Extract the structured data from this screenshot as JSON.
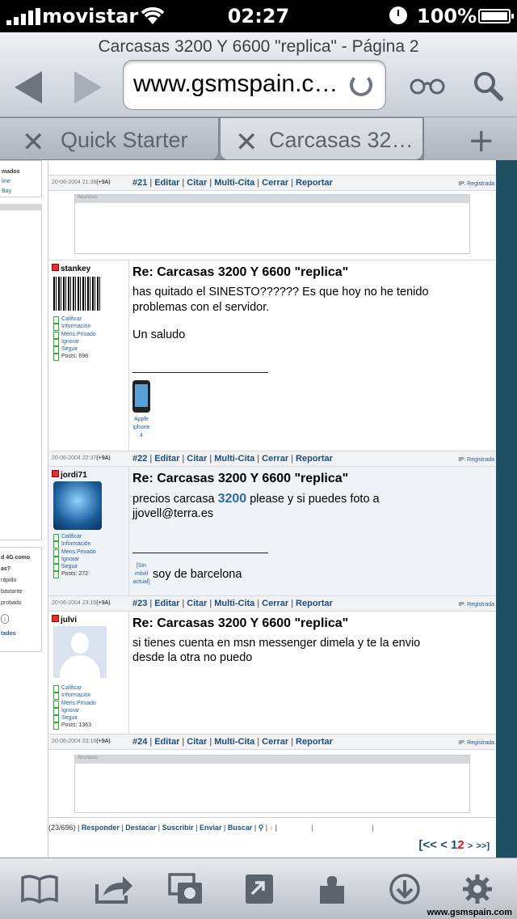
{
  "status": {
    "carrier": "movistar",
    "time": "02:27",
    "battery": "100%"
  },
  "browser": {
    "title": "Carcasas 3200 Y 6600 \"replica\" - Página 2",
    "url": "www.gsmspain.c…"
  },
  "tabs": [
    {
      "label": "Quick Starter"
    },
    {
      "label": "Carcasas 32…"
    }
  ],
  "left": {
    "item1": "mados",
    "item2": "line",
    "item3": "Bay",
    "q1": "d 4G como",
    "q2": "as?",
    "o1": " rápido",
    "o2": " bastante",
    "o3": " probado",
    "btn": "l",
    "link": "tados"
  },
  "ads": {
    "label": "Anuncios"
  },
  "posts": [
    {
      "date": "20-06-2004 21:36",
      "tz": "(+9A)",
      "num": "#21"
    },
    {
      "date": "20-06-2004 22:37",
      "tz": "(+9A)",
      "num": "#22",
      "user": "stankey",
      "title": "Re: Carcasas 3200 Y 6600 \"replica\"",
      "line1": "has quitado el SINESTO?????? Es que hoy no he tenido",
      "line2": "problemas con el servidor.",
      "line3": "Un saludo",
      "posts": "Posts: 698",
      "cap1": "Apple",
      "cap2": "iphone",
      "cap3": "4"
    },
    {
      "date": "20-06-2004 23:16",
      "tz": "(+9A)",
      "num": "#23",
      "user": "jordi71",
      "title": "Re: Carcasas 3200 Y 6600 \"replica\"",
      "line1a": "precios carcasa ",
      "line1b": "3200",
      "line1c": " please y si puedes foto a",
      "line2": "jjovell@terra.es",
      "line3": "soy de barcelona",
      "posts": "Posts: 272",
      "cap1": "[Sin",
      "cap2": "móvil",
      "cap3": "actual]"
    },
    {
      "date": "20-06-2004 23:16",
      "tz": "(+9A)",
      "num": "#24",
      "user": "julvi",
      "title": "Re: Carcasas 3200 Y 6600 \"replica\"",
      "line1": "si tienes cuenta en msn messenger dimela y te la envio",
      "line2": "desde la otra no puedo",
      "posts": "Posts: 1363"
    }
  ],
  "actions": {
    "editar": "Editar",
    "citar": "Citar",
    "multi": "Multi-Cita",
    "cerrar": "Cerrar",
    "reportar": "Reportar",
    "ip": "IP:",
    "reg": "Registrada"
  },
  "userlinks": {
    "a": "Calificar",
    "b": "Información",
    "c": "Mens.Privado",
    "d": "Ignorar",
    "e": "Seguir"
  },
  "footer": {
    "count": "(23/696)",
    "responder": "Responder",
    "destacar": "Destacar",
    "suscribir": "Suscribir",
    "enviar": "Enviar",
    "buscar": "Buscar"
  },
  "pager": {
    "first": "[<<",
    "prev": "<",
    "p1": "1",
    "p2": "2",
    "next": ">",
    "last": ">>]"
  },
  "watermark": "www.gsmspain.com"
}
